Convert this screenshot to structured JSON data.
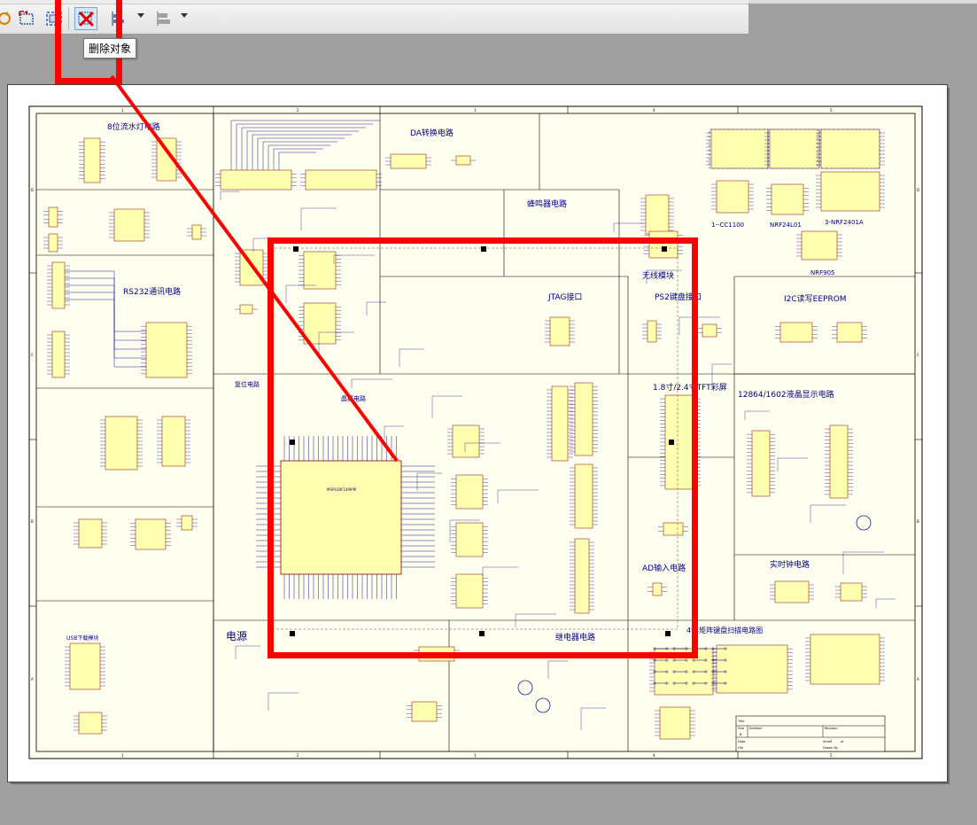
{
  "toolbar": {
    "delete_tooltip": "删除对象"
  },
  "schematic": {
    "sections": [
      {
        "id": "led",
        "title": "8位流水灯电路"
      },
      {
        "id": "da",
        "title": "DA转换电路"
      },
      {
        "id": "rs232",
        "title": "RS232通讯电路"
      },
      {
        "id": "buzzer",
        "title": "蜂鸣器电路"
      },
      {
        "id": "cc1100",
        "title": "1--CC1100"
      },
      {
        "id": "nrf24",
        "title": "NRF24L01"
      },
      {
        "id": "nrf2401a",
        "title": "3-NRF2401A"
      },
      {
        "id": "nrf905",
        "title": "NRF905"
      },
      {
        "id": "wireless",
        "title": "无线模块"
      },
      {
        "id": "jtag",
        "title": "JTAG接口"
      },
      {
        "id": "ps2",
        "title": "PS2键盘接口"
      },
      {
        "id": "i2c",
        "title": "I2C读写EEPROM"
      },
      {
        "id": "reset",
        "title": "复位电路"
      },
      {
        "id": "crystal",
        "title": "晶振电路"
      },
      {
        "id": "tft",
        "title": "1.8寸/2.4寸TFT彩屏"
      },
      {
        "id": "lcd",
        "title": "12864/1602液晶显示电路"
      },
      {
        "id": "ad",
        "title": "AD输入电路"
      },
      {
        "id": "rtc",
        "title": "实时钟电路"
      },
      {
        "id": "power",
        "title": "电源"
      },
      {
        "id": "relay",
        "title": "继电器电路"
      },
      {
        "id": "keypad",
        "title": "4*4矩阵键盘扫描电路图"
      },
      {
        "id": "usb",
        "title": "USB下载模块"
      }
    ],
    "mcu_label": "MSP430F149IPM",
    "title_block": {
      "title": "Title",
      "size": "Size",
      "number": "Number",
      "revision": "Revision",
      "size_value": "B",
      "date": "Date",
      "sheet": "Sheet",
      "of": "of",
      "file": "File",
      "drawn_by": "Drawn By"
    },
    "border_cols": [
      "1",
      "2",
      "3",
      "4",
      "5"
    ],
    "border_rows": [
      "D",
      "C",
      "B",
      "A"
    ]
  },
  "colors": {
    "highlight": "#ff0000",
    "wire": "#1a1a8c",
    "component_fill": "#ffffb0",
    "sheet_fill": "#fffff0",
    "title_text": "#000080"
  }
}
